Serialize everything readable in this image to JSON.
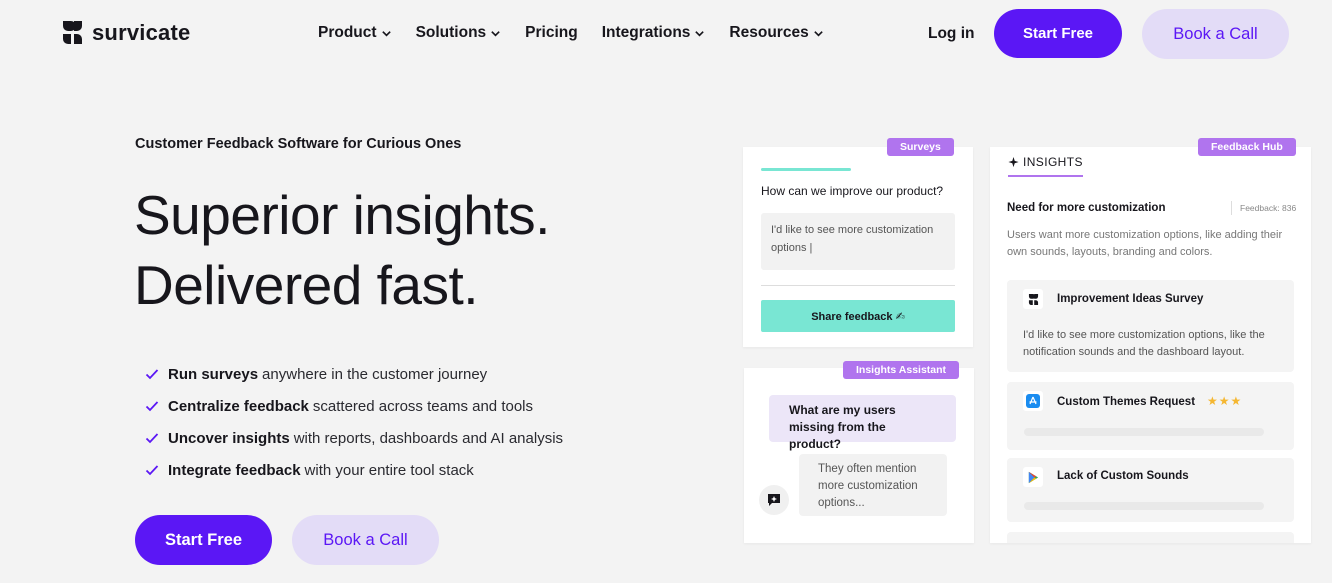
{
  "brand": {
    "name": "survicate",
    "accent": "#5b17f5",
    "accent_soft": "#e3dcf7",
    "tag_color": "#b074ee",
    "mint": "#79e6d3"
  },
  "nav": {
    "items": [
      {
        "label": "Product",
        "has_dropdown": true
      },
      {
        "label": "Solutions",
        "has_dropdown": true
      },
      {
        "label": "Pricing",
        "has_dropdown": false
      },
      {
        "label": "Integrations",
        "has_dropdown": true
      },
      {
        "label": "Resources",
        "has_dropdown": true
      }
    ],
    "login": "Log in",
    "start_free": "Start Free",
    "book_call": "Book a Call"
  },
  "hero": {
    "eyebrow": "Customer Feedback Software for Curious Ones",
    "headline_line1": "Superior insights.",
    "headline_line2": "Delivered fast.",
    "benefits": [
      {
        "bold": "Run surveys",
        "rest": "anywhere in the customer journey"
      },
      {
        "bold": "Centralize feedback",
        "rest": "scattered across teams and tools"
      },
      {
        "bold": "Uncover insights",
        "rest": "with reports, dashboards and AI analysis"
      },
      {
        "bold": "Integrate feedback",
        "rest": "with your entire tool stack"
      }
    ],
    "start_free": "Start Free",
    "book_call": "Book a Call"
  },
  "surveys_card": {
    "tag": "Surveys",
    "question": "How can we improve our product?",
    "answer": "I'd like to see more customization options |",
    "button": "Share feedback ✍"
  },
  "assistant_card": {
    "tag": "Insights Assistant",
    "question": "What are my users missing from the product?",
    "answer": "They often mention more customization options..."
  },
  "hub_card": {
    "tag": "Feedback Hub",
    "insights_label": "INSIGHTS",
    "title": "Need for more customization",
    "count": "Feedback: 836",
    "description": "Users want more customization options, like adding their own sounds, layouts, branding and colors.",
    "items": [
      {
        "icon": "survicate-icon",
        "title": "Improvement Ideas Survey",
        "text": "I'd like to see more customization options, like the notification sounds and the dashboard layout."
      },
      {
        "icon": "app-store-icon",
        "title": "Custom Themes Request",
        "stars": "★★★"
      },
      {
        "icon": "google-play-icon",
        "title": "Lack of Custom Sounds"
      }
    ]
  }
}
